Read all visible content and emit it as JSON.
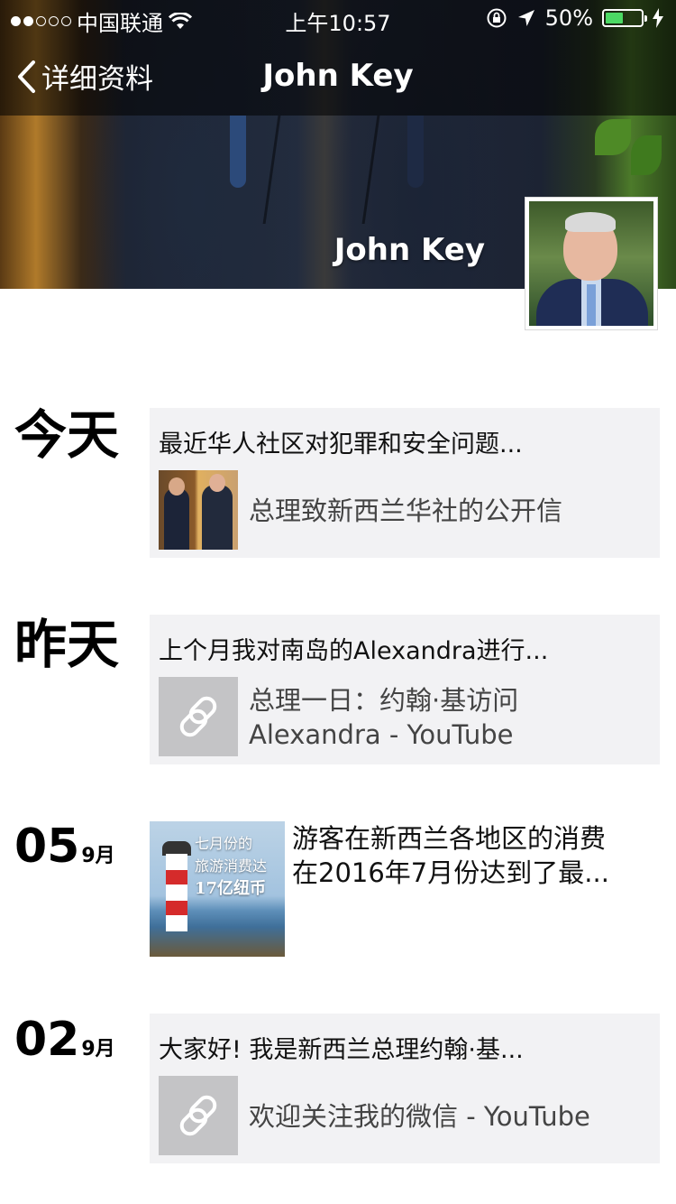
{
  "status_bar": {
    "carrier": "中国联通",
    "time": "上午10:57",
    "battery_percent": "50%",
    "battery_level": 0.5,
    "battery_color": "#4cd964"
  },
  "nav": {
    "back_label": "详细资料",
    "title": "John Key"
  },
  "profile": {
    "name": "John Key"
  },
  "timeline": [
    {
      "date": "今天",
      "title": "最近华人社区对犯罪和安全问题...",
      "link_text": "总理致新西兰华社的公开信",
      "thumb": "photo"
    },
    {
      "date": "昨天",
      "title": "上个月我对南岛的Alexandra进行...",
      "link_text_line1": "总理一日：约翰·基访问",
      "link_text_line2": "Alexandra - YouTube",
      "thumb": "link-icon"
    },
    {
      "day": "05",
      "month": "9月",
      "photo_caption_line1": "七月份的",
      "photo_caption_line2": "旅游消费达",
      "photo_caption_line3": "17亿纽币",
      "text_line1": "游客在新西兰各地区的消费",
      "text_line2": "在2016年7月份达到了最..."
    },
    {
      "day": "02",
      "month": "9月",
      "title": "大家好! 我是新西兰总理约翰·基...",
      "link_text": "欢迎关注我的微信 - YouTube",
      "thumb": "link-icon"
    }
  ]
}
